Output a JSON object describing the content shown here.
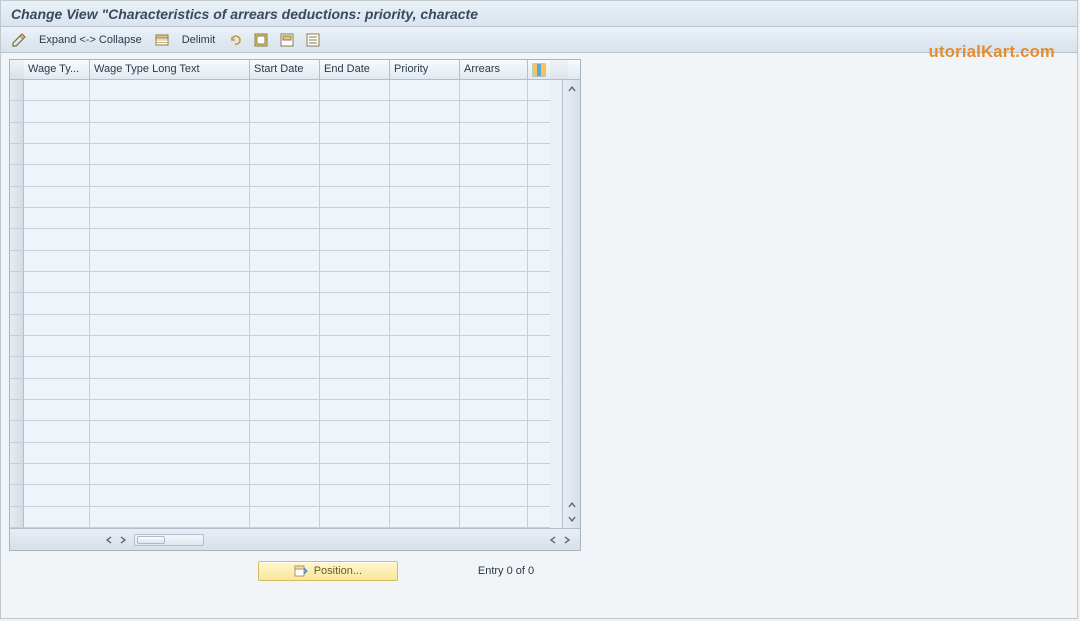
{
  "title": "Change View \"Characteristics of arrears deductions: priority, characte",
  "toolbar": {
    "expand_collapse_label": "Expand <-> Collapse",
    "delimit_label": "Delimit"
  },
  "columns": {
    "wage_type": "Wage Ty...",
    "wage_type_long": "Wage Type Long Text",
    "start_date": "Start Date",
    "end_date": "End Date",
    "priority": "Priority",
    "arrears": "Arrears"
  },
  "rows": [],
  "empty_row_count": 21,
  "footer": {
    "position_label": "Position...",
    "entry_text": "Entry 0 of 0"
  },
  "watermark_text": "utorialKart.com",
  "icons": {
    "pencil": "pencil-icon",
    "overview": "overview-icon",
    "undo": "undo-icon",
    "select_all": "select-all-icon",
    "deselect_all": "deselect-all-icon",
    "config": "table-settings-icon",
    "position": "position-icon"
  }
}
